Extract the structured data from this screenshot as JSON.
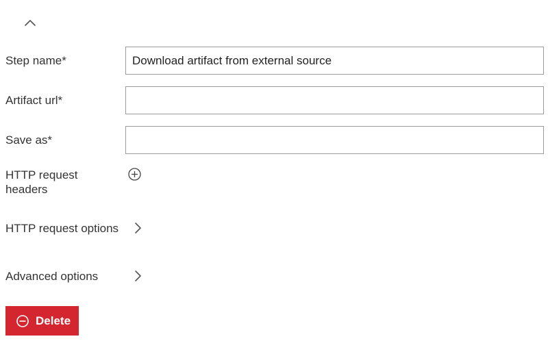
{
  "header": {
    "collapse_icon": "chevron-up-icon"
  },
  "form": {
    "step_name": {
      "label": "Step name*",
      "value": "Download artifact from external source",
      "placeholder": ""
    },
    "artifact_url": {
      "label": "Artifact url*",
      "value": "",
      "placeholder": ""
    },
    "save_as": {
      "label": "Save as*",
      "value": "",
      "placeholder": ""
    },
    "http_headers": {
      "label": "HTTP request headers",
      "add_icon": "plus-circle-icon"
    },
    "http_options": {
      "label": "HTTP request options",
      "expand_icon": "chevron-right-icon"
    },
    "advanced_options": {
      "label": "Advanced options",
      "expand_icon": "chevron-right-icon"
    }
  },
  "actions": {
    "delete_label": "Delete",
    "delete_icon": "minus-circle-icon",
    "delete_color": "#d3262e"
  }
}
